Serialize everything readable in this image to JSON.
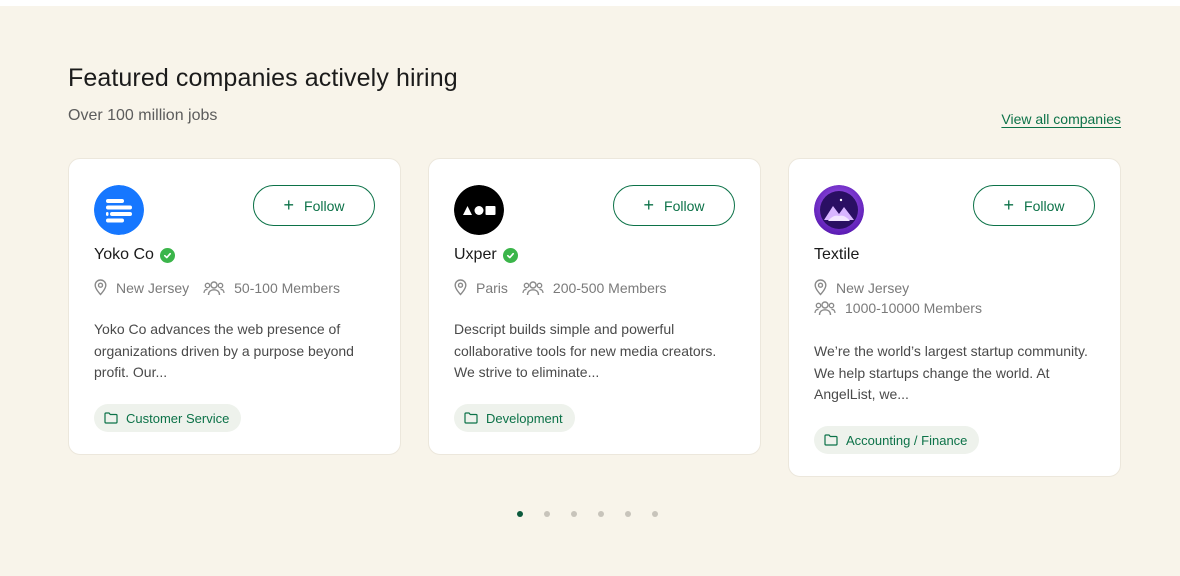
{
  "header": {
    "title": "Featured companies actively hiring",
    "subtitle": "Over 100 million jobs",
    "view_all": "View all companies"
  },
  "follow_label": "Follow",
  "companies": [
    {
      "name": "Yoko Co",
      "verified": true,
      "location": "New Jersey",
      "members": "50-100 Members",
      "description": "Yoko Co advances the web presence of organizations driven by a purpose beyond profit. Our...",
      "tag": "Customer Service",
      "logo_color": "#1677ff"
    },
    {
      "name": "Uxper",
      "verified": true,
      "location": "Paris",
      "members": "200-500 Members",
      "description": "Descript builds simple and powerful collaborative tools for new media creators. We strive to eliminate...",
      "tag": "Development",
      "logo_color": "#000000"
    },
    {
      "name": "Textile",
      "verified": false,
      "location": "New Jersey",
      "members": "1000-10000 Members",
      "description": "We’re the world’s largest startup community. We help startups change the world. At AngelList, we...",
      "tag": "Accounting / Finance",
      "logo_color": "#7b2fd6"
    }
  ],
  "pagination": {
    "pages": 6,
    "active": 1
  },
  "colors": {
    "accent": "#0c7248",
    "background": "#f8f4ea",
    "verified": "#3bb54a",
    "tag_bg": "#eef2ec"
  }
}
